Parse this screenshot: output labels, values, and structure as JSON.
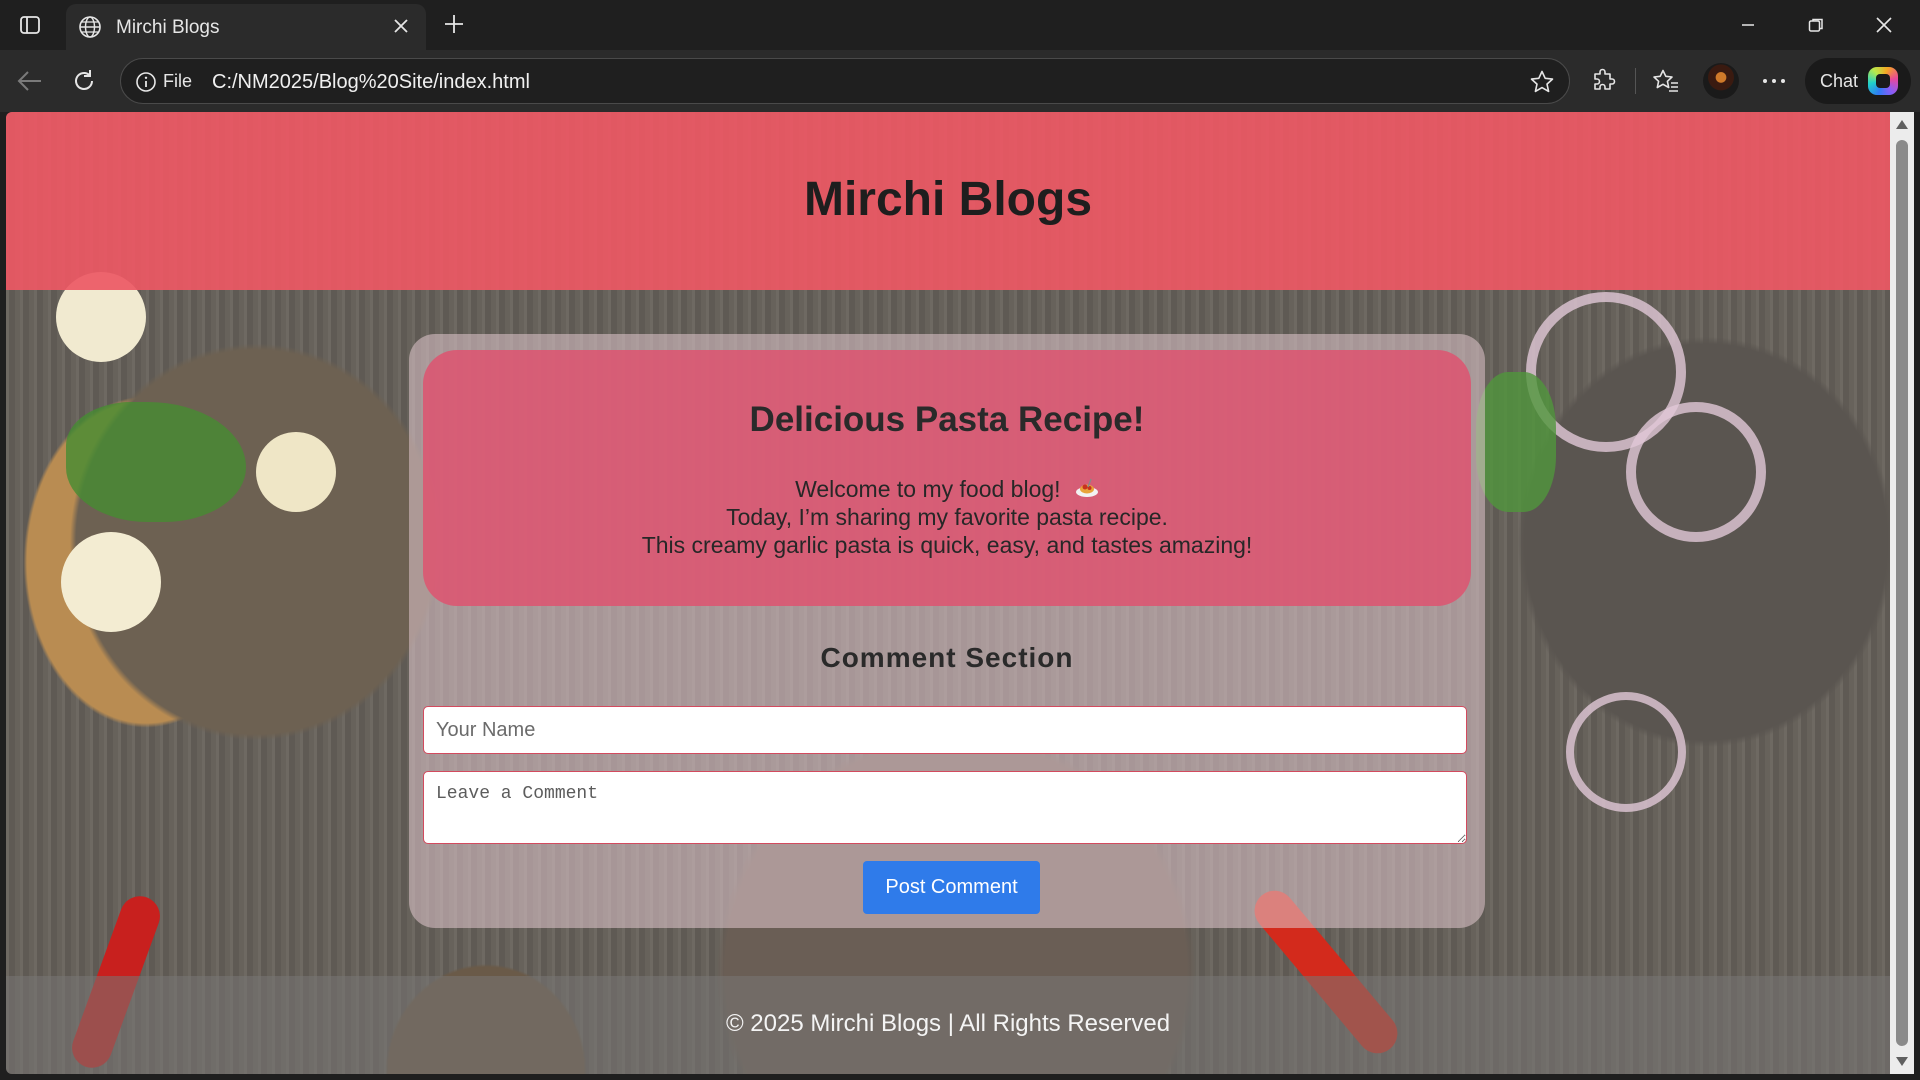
{
  "browser": {
    "tab_title": "Mirchi Blogs",
    "address_scheme": "File",
    "address_url": "C:/NM2025/Blog%20Site/index.html",
    "chat_label": "Chat",
    "icons": [
      "tab-actions-icon",
      "globe-icon",
      "close-icon",
      "plus-icon",
      "minimize-icon",
      "restore-icon",
      "window-close-icon",
      "back-icon",
      "reload-icon",
      "info-icon",
      "star-icon",
      "extensions-icon",
      "favorites-icon",
      "more-icon",
      "copilot-icon"
    ]
  },
  "page": {
    "site_title": "Mirchi Blogs",
    "post": {
      "title": "Delicious Pasta Recipe!",
      "line1": "Welcome to my food blog!",
      "line2": "Today, I’m sharing my favorite pasta recipe.",
      "line3": "This creamy garlic pasta is quick, easy, and tastes amazing!",
      "emoji_icon": "spaghetti-icon"
    },
    "comments": {
      "heading": "Comment Section",
      "name_placeholder": "Your Name",
      "comment_placeholder": "Leave a Comment",
      "button_label": "Post Comment"
    },
    "footer": "© 2025 Mirchi Blogs | All Rights Reserved"
  },
  "colors": {
    "header": "#ED5864",
    "post_card": "#DE5470",
    "button": "#2F7BEA",
    "browser_frame": "#1F1F1F"
  }
}
